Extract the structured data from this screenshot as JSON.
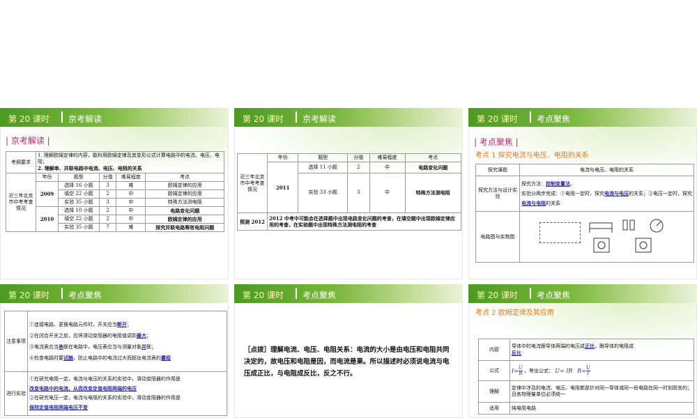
{
  "common": {
    "lesson": "第 20 课时"
  },
  "s1": {
    "header": "京考解读",
    "section": "| 京考解读 |",
    "req_label": "考纲要求",
    "req1": "1. 理解欧姆定律的内容，能利用欧姆定律及其变形公式计算电路中的电流、电压、电阻；",
    "req2": "2. 理解串、并联电路中电流、电压、电阻的关系",
    "cols": [
      "年份",
      "题型",
      "分值",
      "难易程度",
      "考点"
    ],
    "side": "近三年北京市中考考查情况",
    "y1": "2009",
    "y2": "2010",
    "rows": [
      [
        "选择 16 小题",
        "3",
        "难",
        "欧姆定律的应用"
      ],
      [
        "填空 22 小题",
        "2",
        "中",
        "欧姆定律的应用"
      ],
      [
        "实验 35 小题",
        "3",
        "中",
        "特殊方法测电阻"
      ],
      [
        "选择 10 小题",
        "2",
        "中",
        "电路变化问题"
      ],
      [
        "填空 22 小题",
        "2",
        "中",
        "欧姆定律的应用"
      ],
      [
        "实验 35 小题",
        "7",
        "难",
        "探究并联电路等效电阻问题"
      ]
    ]
  },
  "s2": {
    "header": "京考解读",
    "cols": [
      "年份",
      "题型",
      "分值",
      "难易程度",
      "考点"
    ],
    "side": "近三年北京市中考考查情况",
    "year": "2011",
    "rows": [
      [
        "选择 11 小题",
        "2",
        "中",
        "电路变化问题"
      ],
      [
        "实验 33 小题",
        "3",
        "中",
        "特殊方法测电阻"
      ]
    ],
    "pred_label": "预测 2012",
    "pred": "2012 中考中可能会在选择题中出现电路变化问题的考查，在填空题中出现欧姆定律应用的考查，在实验题中出现特殊方法测电阻的考查"
  },
  "s3": {
    "header": "考点聚焦",
    "section": "| 考点聚焦 |",
    "point": "考点 1    探究电流与电压、电阻的关系",
    "topic_label": "探究课题",
    "topic": "电流与电压、电阻的关系",
    "method_label": "探究方法与设计实验",
    "m1": "探究方法：",
    "m1a": "控制变量法",
    "m1end": "。",
    "m2": "实验分两步完成：①电阻一定时，探究",
    "m2a": "电流与电压",
    "m2b": "的关系；②电压一定时，探究",
    "m2c": "电流与电阻",
    "m2d": "的关系",
    "fig_label": "电路图与实物图"
  },
  "s4": {
    "header": "考点聚焦",
    "note_label": "注意事项",
    "n1": "①连接电路、更换电路元件时，开关应当",
    "n1a": "断开",
    "n1e": "；",
    "n2": "②在闭合开关之前，应将滑动变阻器的电阻值调到",
    "n2a": "最大",
    "n2e": "；",
    "n3": "③电流表应当",
    "n3a": "串",
    "n3b": "联在电路中，电压表应当与测量对象",
    "n3c": "并",
    "n3e": "联；",
    "n4": "④检查电路时要",
    "n4a": "试触",
    "n4b": "，防止电路中的电流过大而超出电流表的",
    "n4c": "量程",
    "exp_label": "进行实验",
    "e1": "①在研究电阻一定，电流与电压的关系的实验中，滑动变阻器的作用是",
    "e1a": "改变电路中的电流，从而改变定值电阻两端的电压",
    "e2": "②在研究电压一定，电流与电阻的关系的实验中，滑动变阻器的作用是",
    "e2a": "保持定值电阻两端电压不变"
  },
  "s5": {
    "header": "考点聚焦",
    "note": "［点拨］理解电流、电压、电阻关系：电流的大小是由电压和电阻共同决定的，故电压和电阻是因，而电流是果。所以描述时必须说电流与电压成正比，与电阻成反比，反之不行。"
  },
  "s6": {
    "header": "考点聚焦",
    "point": "考点 2    欧姆定律及其应用",
    "c_label": "内容",
    "c1": "导体中的电流跟导体两端的电压成",
    "c1a": "正比",
    "c2": "，跟导体的电阻成",
    "c2a": "反比",
    "f_label": "公式",
    "f_i": "I=",
    "f_u": "U",
    "f_r": "R",
    "f_mid": "，导出公式：",
    "f_ur": "U= IR",
    "f_rr": "R=",
    "f_u2": "U",
    "f_i2": "I",
    "u_label": "理解",
    "u": "定律中涉及的电流、电压、电阻都是针对同一导体或同一段电路在同一时刻而言的；且各物理量单位必须统一",
    "a_label": "适用",
    "a": "纯电阻电路"
  }
}
